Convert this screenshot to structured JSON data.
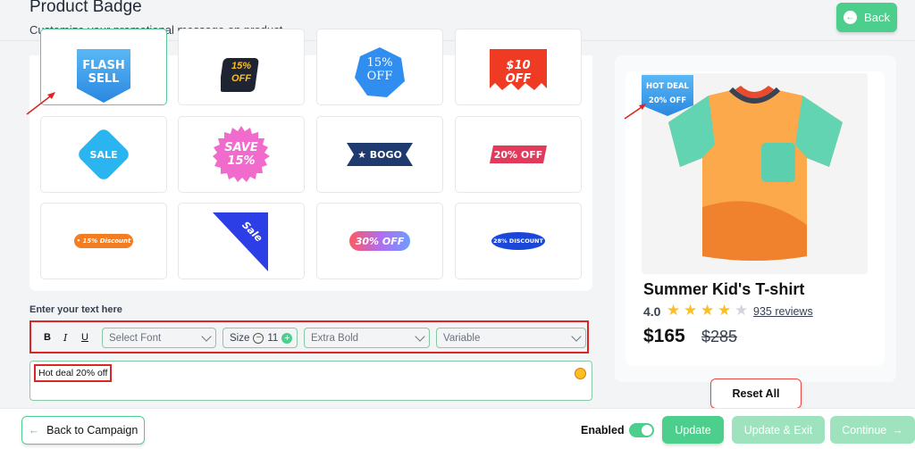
{
  "header": {
    "title": "Product Badge",
    "subtitle": "Customize your promotional message on product.",
    "back_label": "Back"
  },
  "badges": [
    {
      "id": "flash-sell",
      "text_top": "FLASH",
      "text_bottom": "SELL",
      "selected": true
    },
    {
      "id": "15-off-dark",
      "text_top": "15%",
      "text_bottom": "OFF"
    },
    {
      "id": "15-off-blue",
      "text_top": "15%",
      "text_bottom": "OFF"
    },
    {
      "id": "10-off-red",
      "text_top": "$10",
      "text_bottom": "OFF"
    },
    {
      "id": "sale-diamond",
      "text": "SALE"
    },
    {
      "id": "save-15-seal",
      "text_top": "SAVE",
      "text_bottom": "15%"
    },
    {
      "id": "bogo-ribbon",
      "text": "BOGO"
    },
    {
      "id": "20-off-ribbon",
      "text": "20% OFF"
    },
    {
      "id": "15-discount-pill",
      "text": "• 15% Discount"
    },
    {
      "id": "sale-corner",
      "text": "Sale"
    },
    {
      "id": "30-off-gradient",
      "text": "30% OFF"
    },
    {
      "id": "28-discount-oval",
      "text": "28% DISCOUNT"
    }
  ],
  "editor": {
    "label": "Enter your text here",
    "bold": "B",
    "italic": "I",
    "underline": "U",
    "font_placeholder": "Select Font",
    "size_label": "Size",
    "size_value": "11",
    "weight_value": "Extra Bold",
    "variant_value": "Variable",
    "text_value": "Hot deal 20% off"
  },
  "preview": {
    "badge_line1": "HOT DEAL",
    "badge_line2": "20% OFF",
    "product_name": "Summer Kid's T-shirt",
    "rating": "4.0",
    "stars_filled": 4,
    "stars_total": 5,
    "reviews": "935 reviews",
    "price": "$165",
    "old_price": "$285",
    "reset_label": "Reset All"
  },
  "footer": {
    "back_campaign": "Back to Campaign",
    "enabled_label": "Enabled",
    "enabled": true,
    "update": "Update",
    "update_exit": "Update & Exit",
    "continue": "Continue"
  },
  "colors": {
    "accent": "#4ccf8c",
    "accent_disabled": "#9ee3bd",
    "highlight": "#dc2626",
    "star": "#fbbf24"
  }
}
